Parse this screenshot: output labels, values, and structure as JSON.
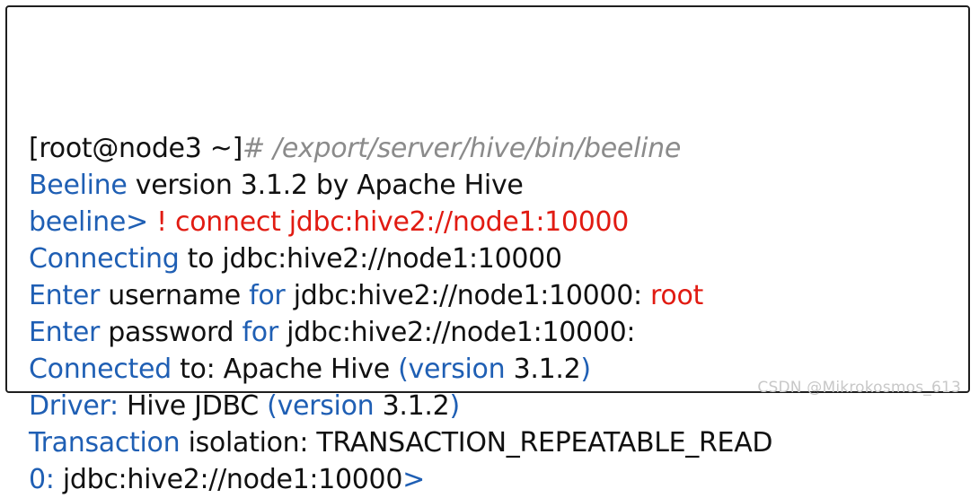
{
  "terminal": {
    "lines": [
      [
        {
          "text": "[root@node3 ~]",
          "color": "black"
        },
        {
          "text": "# /export/server/hive/bin/beeline",
          "color": "gray"
        }
      ],
      [
        {
          "text": "Beeline",
          "color": "blue"
        },
        {
          "text": " version 3.1.2 by Apache Hive",
          "color": "black"
        }
      ],
      [
        {
          "text": "beeline",
          "color": "blue"
        },
        {
          "text": "> ",
          "color": "blue"
        },
        {
          "text": "! connect jdbc:hive2://node1:10000",
          "color": "red"
        }
      ],
      [
        {
          "text": "Connecting",
          "color": "blue"
        },
        {
          "text": " to jdbc:hive2://node1:10000",
          "color": "black"
        }
      ],
      [
        {
          "text": "Enter",
          "color": "blue"
        },
        {
          "text": " username ",
          "color": "black"
        },
        {
          "text": "for",
          "color": "blue"
        },
        {
          "text": " jdbc:hive2://node1:10000: ",
          "color": "black"
        },
        {
          "text": "root",
          "color": "red"
        }
      ],
      [
        {
          "text": "Enter",
          "color": "blue"
        },
        {
          "text": " password ",
          "color": "black"
        },
        {
          "text": "for",
          "color": "blue"
        },
        {
          "text": " jdbc:hive2://node1:10000:",
          "color": "black"
        }
      ],
      [
        {
          "text": "Connected",
          "color": "blue"
        },
        {
          "text": " to: Apache Hive ",
          "color": "black"
        },
        {
          "text": "(version",
          "color": "blue"
        },
        {
          "text": " 3.1.2",
          "color": "black"
        },
        {
          "text": ")",
          "color": "blue"
        }
      ],
      [
        {
          "text": "Driver:",
          "color": "blue"
        },
        {
          "text": " Hive JDBC ",
          "color": "black"
        },
        {
          "text": "(version",
          "color": "blue"
        },
        {
          "text": " 3.1.2",
          "color": "black"
        },
        {
          "text": ")",
          "color": "blue"
        }
      ],
      [
        {
          "text": "Transaction",
          "color": "blue"
        },
        {
          "text": " isolation: TRANSACTION_REPEATABLE_READ",
          "color": "black"
        }
      ],
      [
        {
          "text": "0:",
          "color": "blue"
        },
        {
          "text": " jdbc:hive2://node1:10000",
          "color": "black"
        },
        {
          "text": ">",
          "color": "blue"
        }
      ]
    ]
  },
  "watermark": {
    "text": "CSDN @Mikrokosmos_613"
  },
  "colors": {
    "blue": "#1f5fb4",
    "red": "#e11b12",
    "black": "#111111",
    "gray": "#8b8b8b",
    "frame": "#1f1f1f",
    "watermark": "#c8c8c8"
  }
}
